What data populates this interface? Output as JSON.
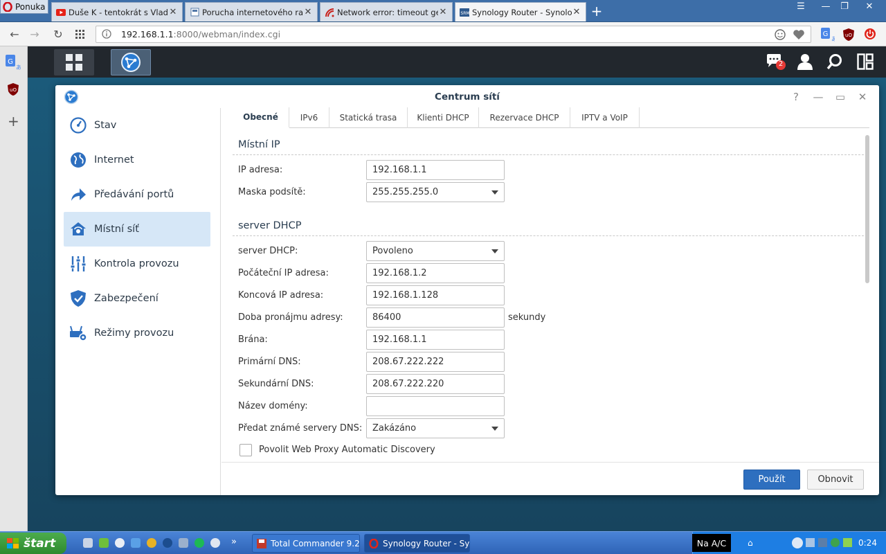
{
  "browser": {
    "menu_label": "Ponuka",
    "tabs": [
      {
        "title": "Duše K - tentokrát s Vladimír..."
      },
      {
        "title": "Porucha internetového radia?"
      },
      {
        "title": "Network error: timeout gettin..."
      },
      {
        "title": "Synology Router - SynologyR..."
      }
    ],
    "url_host": "192.168.1.1",
    "url_rest": ":8000/webman/index.cgi"
  },
  "dsm": {
    "notification_count": "2"
  },
  "window": {
    "title": "Centrum sítí",
    "nav": [
      {
        "label": "Stav"
      },
      {
        "label": "Internet"
      },
      {
        "label": "Předávání portů"
      },
      {
        "label": "Místní síť"
      },
      {
        "label": "Kontrola provozu"
      },
      {
        "label": "Zabezpečení"
      },
      {
        "label": "Režimy provozu"
      }
    ],
    "tabs": [
      {
        "label": "Obecné"
      },
      {
        "label": "IPv6"
      },
      {
        "label": "Statická trasa"
      },
      {
        "label": "Klienti DHCP"
      },
      {
        "label": "Rezervace DHCP"
      },
      {
        "label": "IPTV a VoIP"
      }
    ],
    "local_ip": {
      "section_title": "Místní IP",
      "ip_label": "IP adresa:",
      "ip_value": "192.168.1.1",
      "mask_label": "Maska podsítě:",
      "mask_value": "255.255.255.0"
    },
    "dhcp": {
      "section_title": "server DHCP",
      "server_label": "server DHCP:",
      "server_value": "Povoleno",
      "start_label": "Počáteční IP adresa:",
      "start_value": "192.168.1.2",
      "end_label": "Koncová IP adresa:",
      "end_value": "192.168.1.128",
      "lease_label": "Doba pronájmu adresy:",
      "lease_value": "86400",
      "lease_unit": "sekundy",
      "gateway_label": "Brána:",
      "gateway_value": "192.168.1.1",
      "dns1_label": "Primární DNS:",
      "dns1_value": "208.67.222.222",
      "dns2_label": "Sekundární DNS:",
      "dns2_value": "208.67.222.220",
      "domain_label": "Název domény:",
      "domain_value": "",
      "forward_dns_label": "Předat známé servery DNS:",
      "forward_dns_value": "Zakázáno",
      "wpad_label": "Povolit Web Proxy Automatic Discovery"
    },
    "apply_label": "Použít",
    "reset_label": "Obnovit"
  },
  "taskbar": {
    "start_label": "štart",
    "tasks": [
      {
        "label": "Total Commander 9.2..."
      },
      {
        "label": "Synology Router - Sy..."
      }
    ],
    "language": "Na A/C",
    "clock": "0:24"
  }
}
